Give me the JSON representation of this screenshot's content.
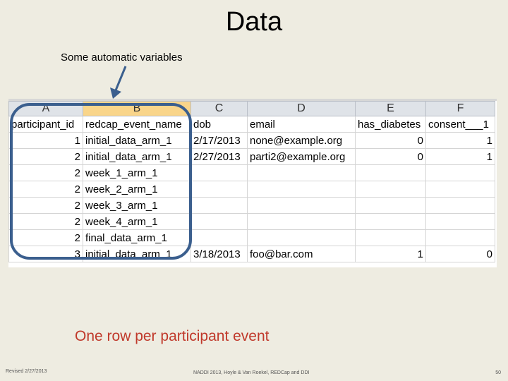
{
  "slide": {
    "title": "Data",
    "annotation": "Some automatic variables",
    "caption": "One row per participant event",
    "footer_left": "Revised 2/27/2013",
    "footer_center": "NADDI 2013, Hoyle & Van Roekel, REDCap and DDI",
    "footer_right": "50"
  },
  "sheet": {
    "column_letters": [
      "A",
      "B",
      "C",
      "D",
      "E",
      "F"
    ],
    "rows": [
      [
        "participant_id",
        "redcap_event_name",
        "dob",
        "email",
        "has_diabetes",
        "consent___1"
      ],
      [
        "1",
        "initial_data_arm_1",
        "2/17/2013",
        "none@example.org",
        "0",
        "1"
      ],
      [
        "2",
        "initial_data_arm_1",
        "2/27/2013",
        "parti2@example.org",
        "0",
        "1"
      ],
      [
        "2",
        "week_1_arm_1",
        "",
        "",
        "",
        ""
      ],
      [
        "2",
        "week_2_arm_1",
        "",
        "",
        "",
        ""
      ],
      [
        "2",
        "week_3_arm_1",
        "",
        "",
        "",
        ""
      ],
      [
        "2",
        "week_4_arm_1",
        "",
        "",
        "",
        ""
      ],
      [
        "2",
        "final_data_arm_1",
        "",
        "",
        "",
        ""
      ],
      [
        "3",
        "initial_data_arm_1",
        "3/18/2013",
        "foo@bar.com",
        "1",
        "0"
      ]
    ]
  },
  "colors": {
    "background": "#eeece1",
    "oval": "#3b5f8e",
    "caption": "#c0392b",
    "selected_column_header": "#f9d58a"
  },
  "icons": [
    "arrow-icon",
    "highlight-oval"
  ]
}
